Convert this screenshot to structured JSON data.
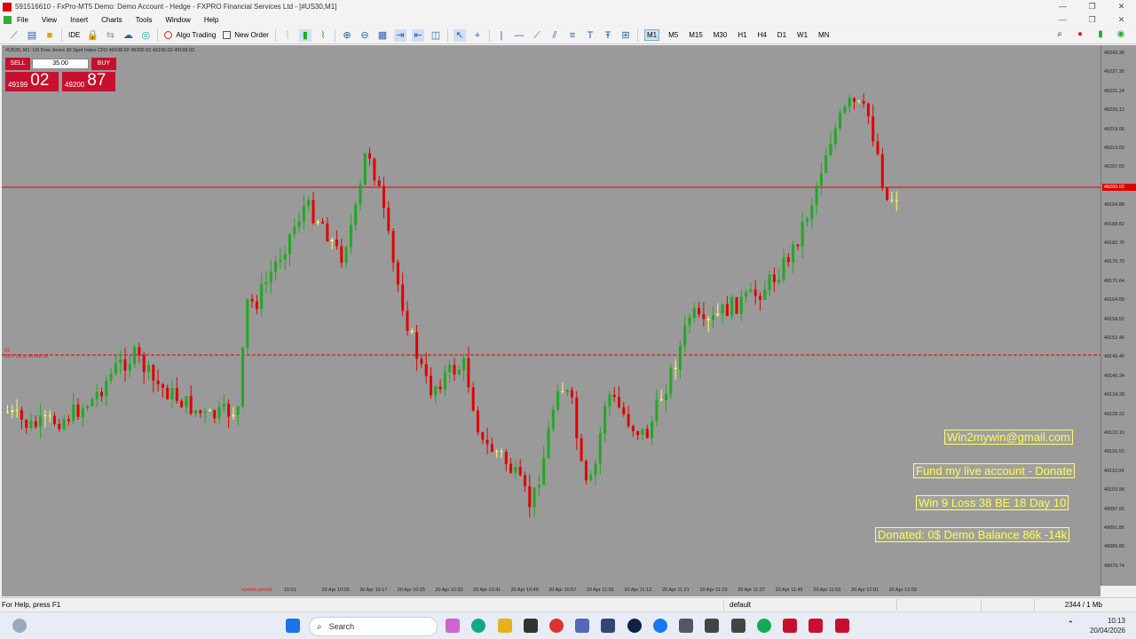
{
  "window": {
    "title": "591516610 - FxPro-MT5 Demo: Demo Account - Hedge - FXPRO Financial Services Ltd - [#US30,M1]",
    "controls": [
      "—",
      "❐",
      "✕"
    ]
  },
  "menu": [
    "File",
    "View",
    "Insert",
    "Charts",
    "Tools",
    "Window",
    "Help"
  ],
  "toolbar": {
    "algo_trading": "Algo Trading",
    "new_order": "New Order",
    "ide": "IDE",
    "timeframes": [
      "M1",
      "M5",
      "M15",
      "M30",
      "H1",
      "H4",
      "D1",
      "W1",
      "MN"
    ],
    "active_timeframe": "M1"
  },
  "chart": {
    "header": "#US30, M1:  US Dow Jones 30 Spot Index CFD  49198.02 49200.02 49196.02 49199.02",
    "symbol_period": "symbol,period",
    "sl_line_label_1": "SL",
    "sl_line_label_2": "BUY 35 at 49146.22",
    "current_price_label": "49200.02",
    "price_ticks": [
      "49243.36",
      "49237.30",
      "49231.24",
      "49225.12",
      "49219.06",
      "49213.00",
      "49207.00",
      "49200.00",
      "49194.88",
      "49188.82",
      "49182.76",
      "49176.70",
      "49170.64",
      "49164.58",
      "49158.52",
      "49152.46",
      "49146.40",
      "49140.34",
      "49134.28",
      "49128.22",
      "49122.16",
      "49116.10",
      "49110.04",
      "49103.98",
      "49097.92",
      "49091.86",
      "49085.80",
      "49079.74"
    ],
    "time_ticks": [
      "20 Apr 10:01",
      "20 Apr 10:09",
      "20 Apr 10:17",
      "20 Apr 10:25",
      "20 Apr 10:33",
      "20 Apr 10:41",
      "20 Apr 10:49",
      "20 Apr 10:57",
      "20 Apr 11:05",
      "20 Apr 11:13",
      "20 Apr 11:21",
      "20 Apr 11:29",
      "20 Apr 11:37",
      "20 Apr 11:45",
      "20 Apr 11:53",
      "20 Apr 12:01",
      "20 Apr 12:09"
    ],
    "colors": {
      "background": "#9a9a9a",
      "bull": "#1faa1f",
      "bear": "#e00000",
      "doji": "#ffff66",
      "current_line": "#e00000"
    }
  },
  "trade_panel": {
    "sell_label": "SELL",
    "buy_label": "BUY",
    "lot": "35.00",
    "bid_small": "49199",
    "bid_big": "02",
    "ask_small": "49200",
    "ask_big": "87"
  },
  "overlay": {
    "email": "Win2mywin@gmail.com",
    "donate": "Fund my live account - Donate",
    "stats": "Win 9  Loss 38  BE 18  Day 10",
    "balance": "Donated: 0$  Demo Balance 86k -14k"
  },
  "status": {
    "help": "For Help, press F1",
    "profile": "default",
    "connection": "2344 / 1 Mb"
  },
  "taskbar": {
    "search_placeholder": "Search",
    "time": "10:13",
    "date": "20/04/2026"
  }
}
